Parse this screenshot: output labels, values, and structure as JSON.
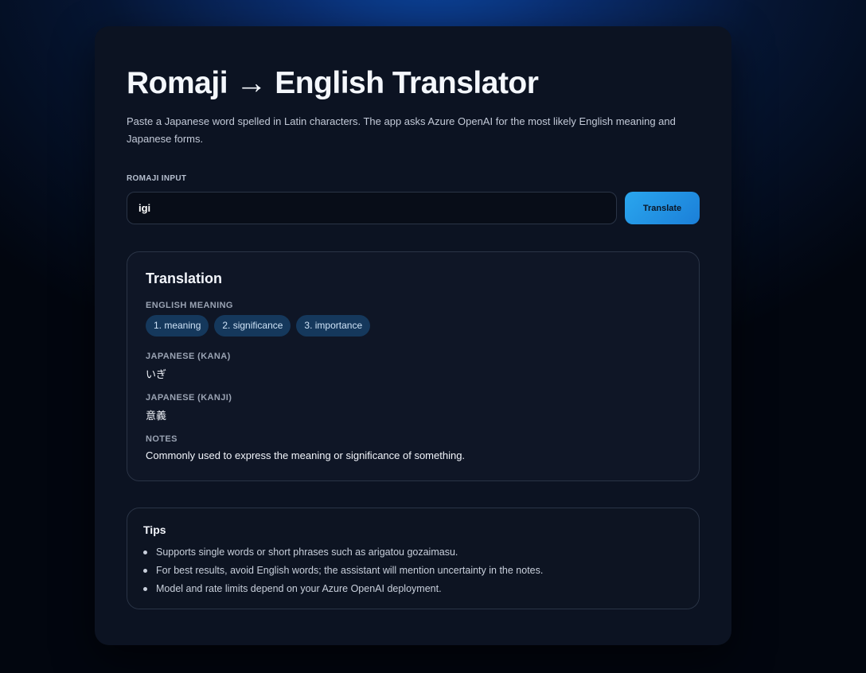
{
  "header": {
    "title": "Romaji → English Translator",
    "subtitle": "Paste a Japanese word spelled in Latin characters. The app asks Azure OpenAI for the most likely English meaning and Japanese forms."
  },
  "form": {
    "label": "ROMAJI INPUT",
    "value": "igi",
    "button_label": "Translate"
  },
  "result": {
    "title": "Translation",
    "english_label": "ENGLISH MEANING",
    "meanings": [
      "1. meaning",
      "2. significance",
      "3. importance"
    ],
    "kana_label": "JAPANESE (KANA)",
    "kana": "いぎ",
    "kanji_label": "JAPANESE (KANJI)",
    "kanji": "意義",
    "notes_label": "NOTES",
    "notes": "Commonly used to express the meaning or significance of something."
  },
  "tips": {
    "title": "Tips",
    "items": [
      "Supports single words or short phrases such as arigatou gozaimasu.",
      "For best results, avoid English words; the assistant will mention uncertainty in the notes.",
      "Model and rate limits depend on your Azure OpenAI deployment."
    ]
  },
  "colors": {
    "accent": "#2aa6ee",
    "card_background": "#0c1322",
    "chip_background": "#15385c"
  }
}
